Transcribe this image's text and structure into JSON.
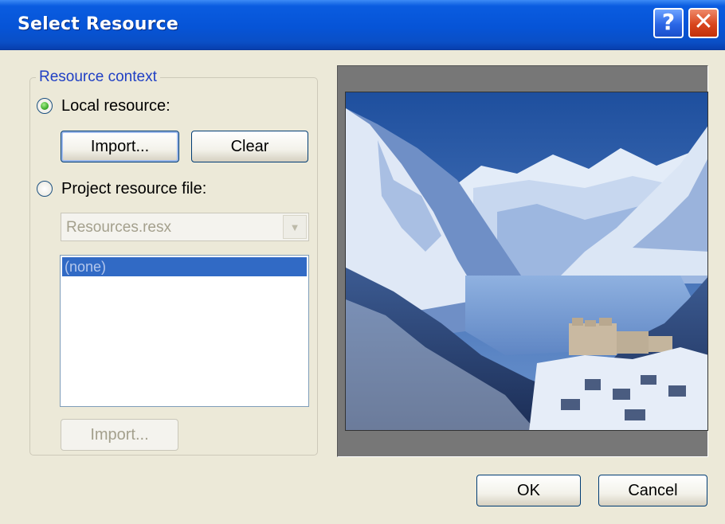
{
  "window": {
    "title": "Select Resource",
    "help_label": "?",
    "close_label": "✕"
  },
  "resource_context": {
    "legend": "Resource context",
    "local_resource_label": "Local resource:",
    "local_resource_selected": true,
    "import_label": "Import...",
    "clear_label": "Clear",
    "project_resource_label": "Project resource file:",
    "project_resource_selected": false,
    "resource_file": {
      "value": "Resources.resx",
      "arrow": "▼"
    },
    "resources_list": {
      "items": [
        "(none)"
      ]
    },
    "project_import_label": "Import..."
  },
  "preview": {
    "image_subject": "snowy mountain lake with hotel",
    "icon": "image-icon"
  },
  "footer": {
    "ok_label": "OK",
    "cancel_label": "Cancel"
  },
  "colors": {
    "title_bar": "#0654d7",
    "dialog_bg": "#ece9d8",
    "legend_text": "#1f3fc4",
    "selection": "#316ac5"
  }
}
